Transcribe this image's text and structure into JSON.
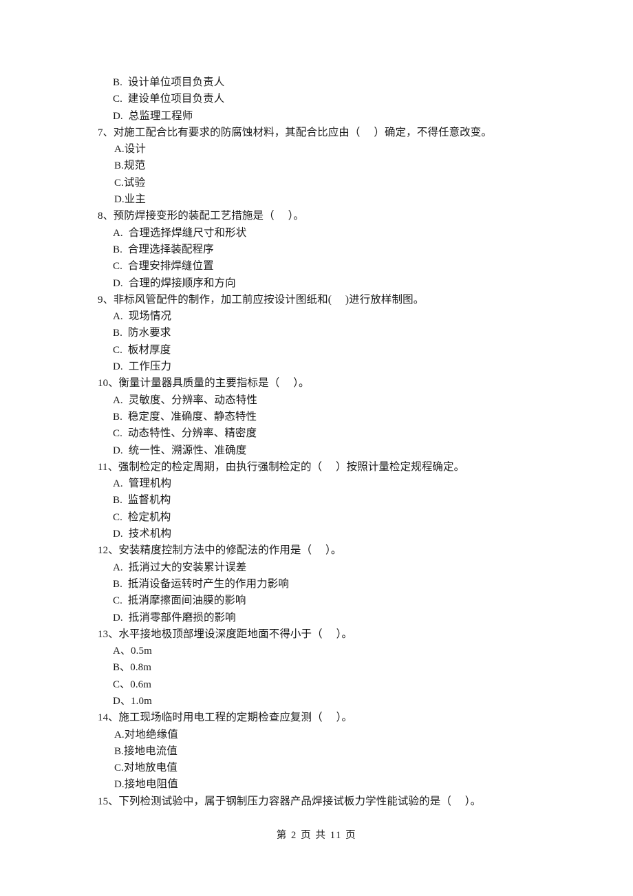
{
  "document": {
    "type": "exam-paper",
    "language": "zh-CN",
    "footer": "第 2 页 共 11 页",
    "page_number": 2,
    "total_pages": 11,
    "text_color": "#1a1a1a",
    "background_color": "#ffffff"
  },
  "continued_options": [
    {
      "label": "B.",
      "text": "设计单位项目负责人"
    },
    {
      "label": "C.",
      "text": "建设单位项目负责人"
    },
    {
      "label": "D.",
      "text": "总监理工程师"
    }
  ],
  "questions": [
    {
      "number": "7、",
      "stem": "对施工配合比有要求的防腐蚀材料，其配合比应由（     ）确定，不得任意改变。",
      "options": [
        {
          "label": "A.",
          "text": "设计"
        },
        {
          "label": "B.",
          "text": "规范"
        },
        {
          "label": "C.",
          "text": "试验"
        },
        {
          "label": "D.",
          "text": "业主"
        }
      ]
    },
    {
      "number": "8、",
      "stem": "预防焊接变形的装配工艺措施是（     ）。",
      "options": [
        {
          "label": "A.",
          "text": "合理选择焊缝尺寸和形状"
        },
        {
          "label": "B.",
          "text": "合理选择装配程序"
        },
        {
          "label": "C.",
          "text": "合理安排焊缝位置"
        },
        {
          "label": "D.",
          "text": "合理的焊接顺序和方向"
        }
      ]
    },
    {
      "number": "9、",
      "stem": "非标风管配件的制作，加工前应按设计图纸和(     )进行放样制图。",
      "options": [
        {
          "label": "A.",
          "text": "现场情况"
        },
        {
          "label": "B.",
          "text": "防水要求"
        },
        {
          "label": "C.",
          "text": "板材厚度"
        },
        {
          "label": "D.",
          "text": "工作压力"
        }
      ]
    },
    {
      "number": "10、",
      "stem": "衡量计量器具质量的主要指标是（     ）。",
      "options": [
        {
          "label": "A.",
          "text": "灵敏度、分辨率、动态特性"
        },
        {
          "label": "B.",
          "text": "稳定度、准确度、静态特性"
        },
        {
          "label": "C.",
          "text": "动态特性、分辨率、精密度"
        },
        {
          "label": "D.",
          "text": "统一性、溯源性、准确度"
        }
      ]
    },
    {
      "number": "11、",
      "stem": "强制检定的检定周期，由执行强制检定的（     ）按照计量检定规程确定。",
      "options": [
        {
          "label": "A.",
          "text": "管理机构"
        },
        {
          "label": "B.",
          "text": "监督机构"
        },
        {
          "label": "C.",
          "text": "检定机构"
        },
        {
          "label": "D.",
          "text": "技术机构"
        }
      ]
    },
    {
      "number": "12、",
      "stem": "安装精度控制方法中的修配法的作用是（     ）。",
      "options": [
        {
          "label": "A.",
          "text": "抵消过大的安装累计误差"
        },
        {
          "label": "B.",
          "text": "抵消设备运转时产生的作用力影响"
        },
        {
          "label": "C.",
          "text": "抵消摩擦面间油膜的影响"
        },
        {
          "label": "D.",
          "text": "抵消零部件磨损的影响"
        }
      ]
    },
    {
      "number": "13、",
      "stem": "水平接地极顶部埋设深度距地面不得小于（     ）。",
      "options": [
        {
          "label": "A、",
          "text": "0.5m"
        },
        {
          "label": "B、",
          "text": "0.8m"
        },
        {
          "label": "C、",
          "text": "0.6m"
        },
        {
          "label": "D、",
          "text": "1.0m"
        }
      ]
    },
    {
      "number": "14、",
      "stem": "施工现场临时用电工程的定期检查应复测（     ）。",
      "options": [
        {
          "label": "A.",
          "text": "对地绝缘值"
        },
        {
          "label": "B.",
          "text": "接地电流值"
        },
        {
          "label": "C.",
          "text": "对地放电值"
        },
        {
          "label": "D.",
          "text": "接地电阻值"
        }
      ]
    },
    {
      "number": "15、",
      "stem": "下列检测试验中，属于钢制压力容器产品焊接试板力学性能试验的是（     ）。",
      "options": []
    }
  ]
}
